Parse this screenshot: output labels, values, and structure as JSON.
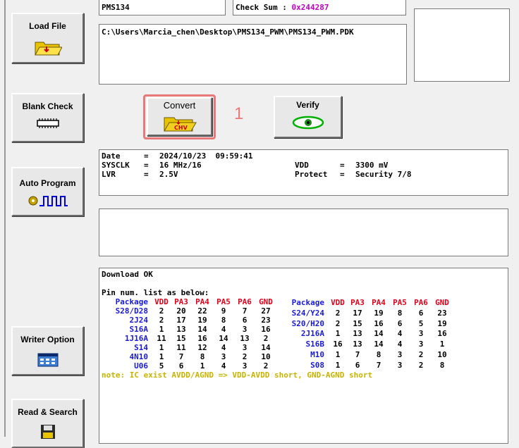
{
  "top": {
    "chip_name": "PMS134",
    "checksum_label": "Check Sum : ",
    "checksum_value": "0x244287"
  },
  "file_path": "C:\\Users\\Marcia_chen\\Desktop\\PMS134_PWM\\PMS134_PWM.PDK",
  "side_buttons": {
    "load_file": "Load File",
    "blank_check": "Blank Check",
    "auto_program": "Auto Program",
    "writer_option": "Writer Option",
    "read_search": "Read & Search"
  },
  "action_buttons": {
    "convert": "Convert",
    "verify": "Verify",
    "convert_icon_text": "CHV"
  },
  "annotation": "1",
  "info": {
    "date_label": "Date",
    "date_value": "2024/10/23  09:59:41",
    "sysclk_label": "SYSCLK",
    "sysclk_value": "16 MHz/16",
    "lvr_label": "LVR",
    "lvr_value": "2.5V",
    "vdd_label": "VDD",
    "vdd_value": "3300 mV",
    "protect_label": "Protect",
    "protect_value": "Security 7/8",
    "eq": "="
  },
  "log": {
    "status": "Download OK",
    "pin_list_title": "Pin num. list as below:",
    "headers": [
      "Package",
      "VDD",
      "PA3",
      "PA4",
      "PA5",
      "PA6",
      "GND"
    ],
    "left_rows": [
      [
        "S28/D28",
        "2",
        "20",
        "22",
        "9",
        "7",
        "27"
      ],
      [
        "2J24",
        "2",
        "17",
        "19",
        "8",
        "6",
        "23"
      ],
      [
        "S16A",
        "1",
        "13",
        "14",
        "4",
        "3",
        "16"
      ],
      [
        "1J16A",
        "11",
        "15",
        "16",
        "14",
        "13",
        "2"
      ],
      [
        "S14",
        "1",
        "11",
        "12",
        "4",
        "3",
        "14"
      ],
      [
        "4N10",
        "1",
        "7",
        "8",
        "3",
        "2",
        "10"
      ],
      [
        "U06",
        "5",
        "6",
        "1",
        "4",
        "3",
        "2"
      ]
    ],
    "right_rows": [
      [
        "S24/Y24",
        "2",
        "17",
        "19",
        "8",
        "6",
        "23"
      ],
      [
        "S20/H20",
        "2",
        "15",
        "16",
        "6",
        "5",
        "19"
      ],
      [
        "2J16A",
        "1",
        "13",
        "14",
        "4",
        "3",
        "16"
      ],
      [
        "S16B",
        "16",
        "13",
        "14",
        "4",
        "3",
        "1"
      ],
      [
        "M10",
        "1",
        "7",
        "8",
        "3",
        "2",
        "10"
      ],
      [
        "S08",
        "1",
        "6",
        "7",
        "3",
        "2",
        "8"
      ]
    ],
    "note": "note: IC exist AVDD/AGND => VDD-AVDD short, GND-AGND short"
  },
  "colors": {
    "highlight": "#e8787a",
    "header_red": "#e2001a",
    "package_blue": "#1a1adb",
    "note_yellow": "#c8b400",
    "checksum_magenta": "#c000c0"
  }
}
